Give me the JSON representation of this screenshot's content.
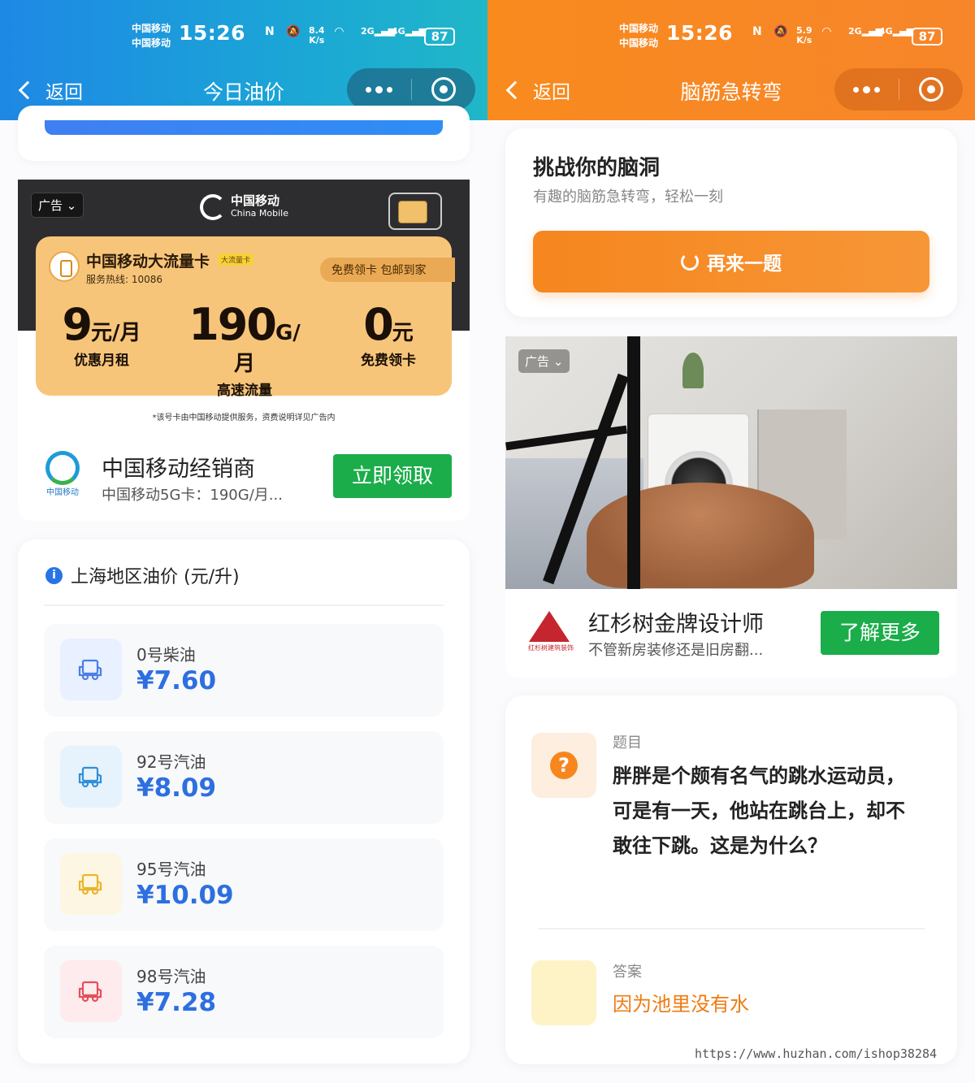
{
  "status_bar": {
    "carrier_1": "中国移动",
    "carrier_2": "中国移动",
    "time": "15:26",
    "left_speed": "8.4",
    "right_speed": "5.9",
    "speed_unit": "K/s",
    "net_2g": "2G",
    "net_4g": "4G",
    "battery": "87"
  },
  "left": {
    "nav": {
      "back_label": "返回",
      "title": "今日油价"
    },
    "ad": {
      "tag": "广告",
      "brand_cn": "中国移动",
      "brand_en": "China Mobile",
      "promo_title": "中国移动大流量卡",
      "promo_badge": "大流量卡",
      "hotline": "服务热线: 10086",
      "free_ship": "免费领卡 包邮到家",
      "stats": [
        {
          "num": "9",
          "unit": "元/月",
          "label": "优惠月租"
        },
        {
          "num": "190",
          "unit": "G/月",
          "label": "高速流量"
        },
        {
          "num": "0",
          "unit": "元",
          "label": "免费领卡"
        }
      ],
      "disclaimer": "*该号卡由中国移动提供服务，资费说明详见广告内",
      "advertiser_logo_text": "中国移动",
      "advertiser_name": "中国移动经销商",
      "advertiser_desc": "中国移动5G卡：190G/月...",
      "cta": "立即领取"
    },
    "prices": {
      "heading": "上海地区油价 (元/升)",
      "items": [
        {
          "name": "0号柴油",
          "price": "¥7.60",
          "color": "#4a7fe6",
          "bg": "#e9f0ff"
        },
        {
          "name": "92号汽油",
          "price": "¥8.09",
          "color": "#2f8fd8",
          "bg": "#e6f3fc"
        },
        {
          "name": "95号汽油",
          "price": "¥10.09",
          "color": "#e9b52a",
          "bg": "#fdf6e2"
        },
        {
          "name": "98号汽油",
          "price": "¥7.28",
          "color": "#e2505a",
          "bg": "#fdebed"
        }
      ]
    }
  },
  "right": {
    "nav": {
      "back_label": "返回",
      "title": "脑筋急转弯"
    },
    "challenge": {
      "title": "挑战你的脑洞",
      "subtitle": "有趣的脑筋急转弯，轻松一刻",
      "button": "再来一题"
    },
    "ad": {
      "tag": "广告",
      "advertiser_logo_text": "红杉树建筑装饰",
      "advertiser_name": "红杉树金牌设计师",
      "advertiser_desc": "不管新房装修还是旧房翻...",
      "cta": "了解更多"
    },
    "riddle": {
      "question_label": "题目",
      "question": "胖胖是个颇有名气的跳水运动员，可是有一天，他站在跳台上，却不敢往下跳。这是为什么？",
      "answer_label": "答案",
      "answer": "因为池里没有水"
    },
    "watermark": "https://www.huzhan.com/ishop38284"
  }
}
